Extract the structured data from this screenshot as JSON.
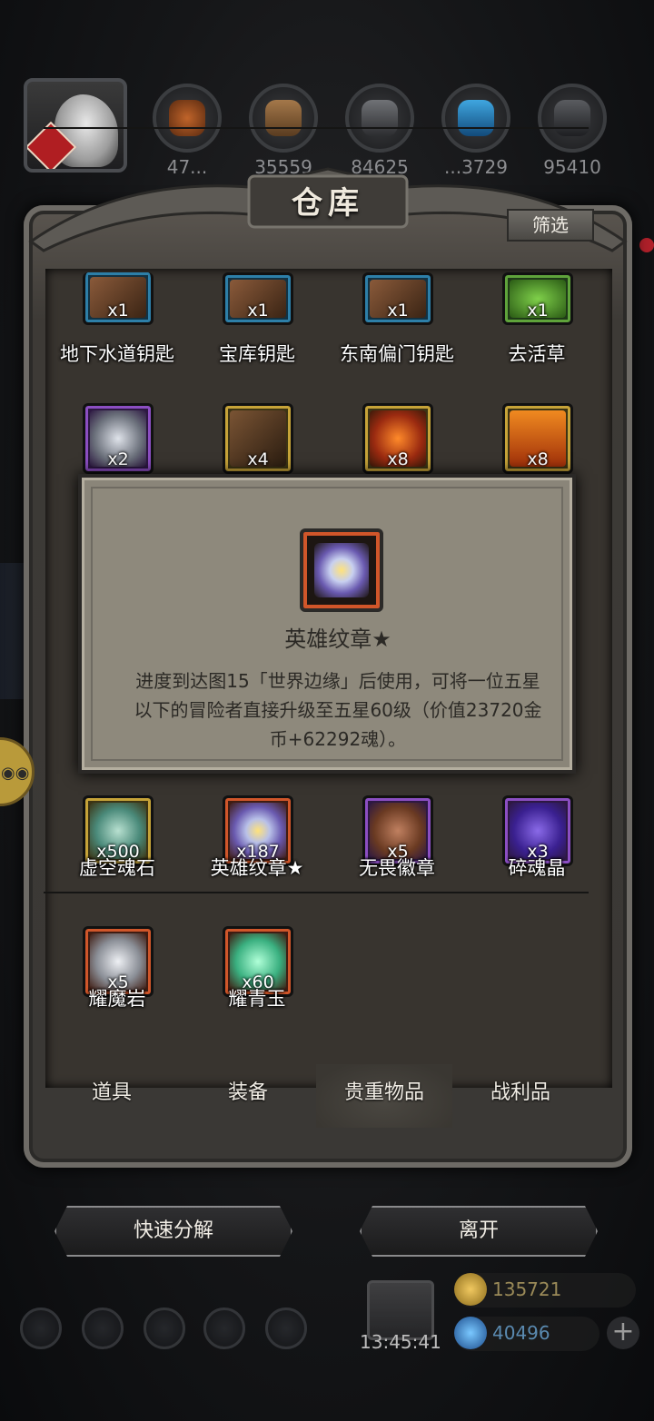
{
  "resources_top": {
    "values": [
      "47...",
      "35559",
      "84625",
      "...3729",
      "95410"
    ]
  },
  "panel": {
    "title": "仓库",
    "filter_label": "筛选"
  },
  "items": [
    {
      "name": "地下水道钥匙",
      "count": "x1",
      "rarity": "blue",
      "icon": "key-icon"
    },
    {
      "name": "宝库钥匙",
      "count": "x1",
      "rarity": "blue",
      "icon": "key-icon"
    },
    {
      "name": "东南偏门钥匙",
      "count": "x1",
      "rarity": "blue",
      "icon": "key-icon"
    },
    {
      "name": "去活草",
      "count": "x1",
      "rarity": "green",
      "icon": "herb-icon"
    },
    {
      "name": "",
      "count": "x2",
      "rarity": "purple",
      "icon": "silver-disc-icon"
    },
    {
      "name": "",
      "count": "x4",
      "rarity": "gold",
      "icon": "key-icon"
    },
    {
      "name": "",
      "count": "x8",
      "rarity": "gold",
      "icon": "fire-orb-icon"
    },
    {
      "name": "",
      "count": "x8",
      "rarity": "gold",
      "icon": "rune-scroll-icon"
    },
    {
      "name": "虚空魂石",
      "count": "x500",
      "rarity": "gold",
      "icon": "crystal-icon"
    },
    {
      "name": "英雄纹章★",
      "count": "x187",
      "rarity": "orange",
      "icon": "crest-icon"
    },
    {
      "name": "无畏徽章",
      "count": "x5",
      "rarity": "purple",
      "icon": "shield-badge-icon"
    },
    {
      "name": "碎魂晶",
      "count": "x3",
      "rarity": "purple",
      "icon": "soul-crystal-icon"
    },
    {
      "name": "耀魔岩",
      "count": "x5",
      "rarity": "orange",
      "icon": "rock-icon"
    },
    {
      "name": "耀青玉",
      "count": "x60",
      "rarity": "orange",
      "icon": "jade-icon"
    }
  ],
  "tooltip": {
    "name": "英雄纹章★",
    "description": "进度到达图15「世界边缘」后使用，可将一位五星以下的冒险者直接升级至五星60级（价值23720金币+62292魂）。",
    "icon": "crest-icon"
  },
  "tabs": [
    {
      "label": "道具",
      "active": false
    },
    {
      "label": "装备",
      "active": false
    },
    {
      "label": "贵重物品",
      "active": true
    },
    {
      "label": "战利品",
      "active": false
    }
  ],
  "actions": {
    "quick_decompose": "快速分解",
    "leave": "离开"
  },
  "hud": {
    "time": "13:45:41",
    "gold": "135721",
    "gems": "40496",
    "plus": "+"
  },
  "colors": {
    "rarity_blue": "#2d7fa8",
    "rarity_green": "#5fa33b",
    "rarity_purple": "#8b4ec2",
    "rarity_gold": "#c6a338",
    "rarity_orange": "#d0562a"
  }
}
